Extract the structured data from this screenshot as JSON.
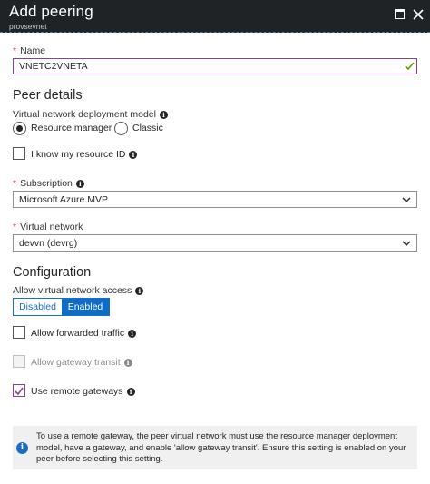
{
  "header": {
    "title": "Add peering",
    "subtitle": "provsevnet"
  },
  "name": {
    "label": "Name",
    "required_mark": "*",
    "value": "VNETC2VNETA"
  },
  "peer_details": {
    "heading": "Peer details",
    "deployment_model_label": "Virtual network deployment model",
    "options": [
      {
        "label": "Resource manager",
        "selected": true
      },
      {
        "label": "Classic",
        "selected": false
      }
    ],
    "know_resource_id_label": "I know my resource ID",
    "subscription": {
      "label": "Subscription",
      "required_mark": "*",
      "value": "Microsoft Azure MVP"
    },
    "virtual_network": {
      "label": "Virtual network",
      "required_mark": "*",
      "value": "devvn (devrg)"
    }
  },
  "configuration": {
    "heading": "Configuration",
    "allow_access_label": "Allow virtual network access",
    "toggle": {
      "off_label": "Disabled",
      "on_label": "Enabled",
      "selected": "Enabled"
    },
    "allow_forwarded_label": "Allow forwarded traffic",
    "allow_gateway_transit_label": "Allow gateway transit",
    "use_remote_gateways_label": "Use remote gateways"
  },
  "banner": {
    "text": "To use a remote gateway, the peer virtual network must use the resource manager deployment model, have a gateway, and enable 'allow gateway transit'. Ensure this setting is enabled on your peer before selecting this setting."
  },
  "colors": {
    "header_bg": "#1f2326",
    "accent_blue": "#0f6cc6",
    "focus_purple": "#8a3f9f",
    "valid_green": "#57a300",
    "required_red": "#d93b3b"
  }
}
